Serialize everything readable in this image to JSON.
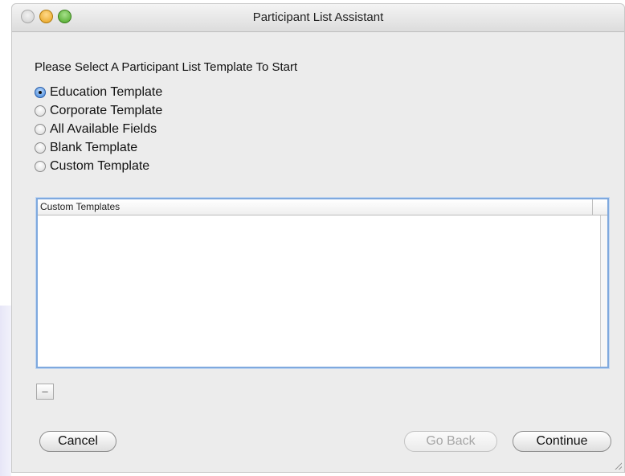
{
  "window": {
    "title": "Participant List Assistant"
  },
  "prompt": "Please Select A Participant List Template To Start",
  "options": [
    {
      "label": "Education Template",
      "checked": true
    },
    {
      "label": "Corporate Template",
      "checked": false
    },
    {
      "label": "All Available Fields",
      "checked": false
    },
    {
      "label": "Blank Template",
      "checked": false
    },
    {
      "label": "Custom Template",
      "checked": false
    }
  ],
  "custom_list": {
    "header": "Custom Templates",
    "items": []
  },
  "remove_button": {
    "label": "–"
  },
  "buttons": {
    "cancel": "Cancel",
    "go_back": "Go Back",
    "continue": "Continue"
  },
  "colors": {
    "accent": "#3b7fd6",
    "list_focus_border": "#7fa9de",
    "disabled_text": "#a6a6a6"
  }
}
